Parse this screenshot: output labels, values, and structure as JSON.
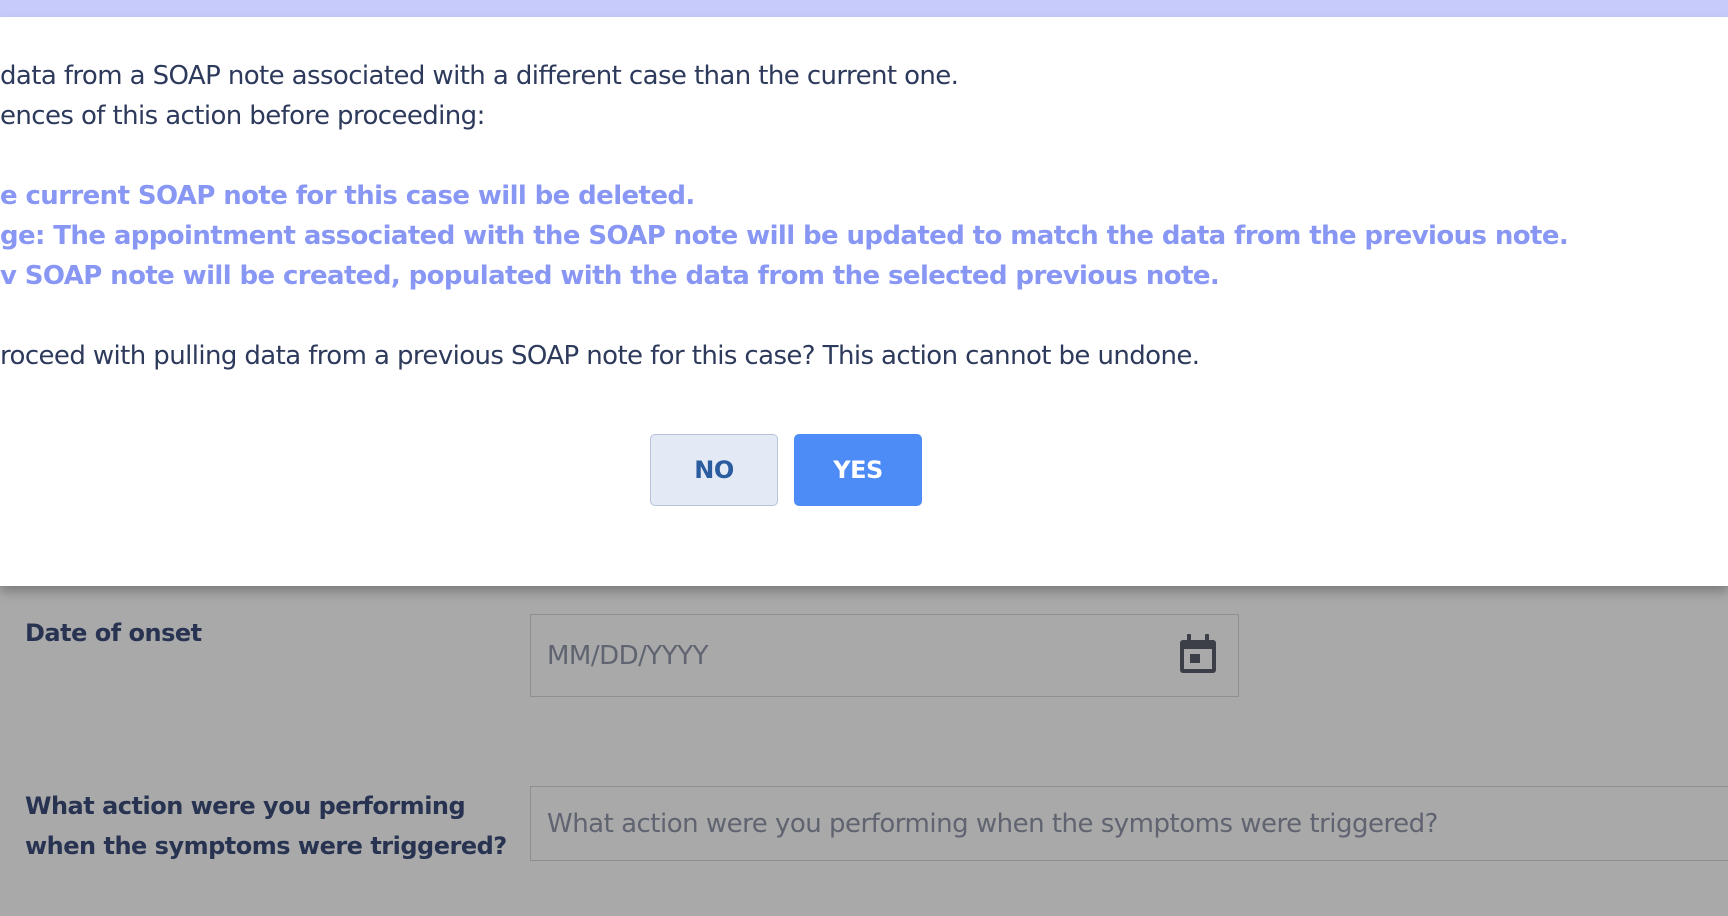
{
  "modal": {
    "intro_line1": "data from a SOAP note associated with a different case than the current one.",
    "intro_line2": "ences of this action before proceeding:",
    "warning1": "e current SOAP note for this case will be deleted.",
    "warning2": "ge: The appointment associated with the SOAP note will be updated to match the data from the previous note.",
    "warning3": "v SOAP note will be created, populated with the data from the selected previous note.",
    "question": "roceed with pulling data from a previous SOAP note for this case? This action cannot be undone.",
    "no_label": "NO",
    "yes_label": "YES"
  },
  "form": {
    "date_of_onset_label": "Date of onset",
    "date_placeholder": "MM/DD/YYYY",
    "action_label_line1": "What action were you performing",
    "action_label_line2": "when the symptoms were triggered?",
    "action_placeholder": "What action were you performing when the symptoms were triggered?"
  },
  "icons": {
    "date_picker": "calendar-icon"
  },
  "colors": {
    "accent": "#4d8cf6",
    "warning_text": "#8896f4",
    "overlay": "#a9a9a9",
    "top_bar": "#c6cbfb"
  }
}
